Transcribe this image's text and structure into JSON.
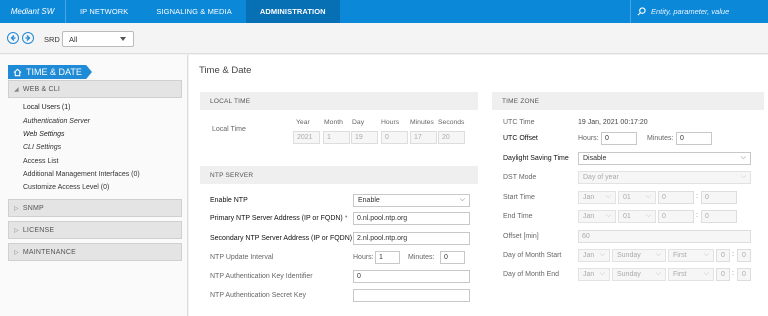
{
  "topbar": {
    "brand": "Mediant SW",
    "tabs": [
      {
        "label": "IP NETWORK"
      },
      {
        "label": "SIGNALING & MEDIA"
      },
      {
        "label": "ADMINISTRATION"
      }
    ],
    "search_placeholder": "Entity, parameter, value"
  },
  "subbar": {
    "srd_label": "SRD",
    "srd_value": "All"
  },
  "sidebar": {
    "title": "TIME & DATE",
    "groups": {
      "web_cli": "WEB & CLI",
      "snmp": "SNMP",
      "license": "LICENSE",
      "maintenance": "MAINTENANCE"
    },
    "items": [
      "Local Users (1)",
      "Authentication Server",
      "Web Settings",
      "CLI Settings",
      "Access List",
      "Additional Management Interfaces (0)",
      "Customize Access Level (0)"
    ]
  },
  "page": {
    "title": "Time & Date"
  },
  "local_time": {
    "header": "LOCAL TIME",
    "label": "Local Time",
    "cols": [
      "Year",
      "Month",
      "Day",
      "Hours",
      "Minutes",
      "Seconds"
    ],
    "values": [
      "2021",
      "1",
      "19",
      "0",
      "17",
      "20"
    ]
  },
  "ntp": {
    "header": "NTP SERVER",
    "enable_label": "Enable NTP",
    "enable_value": "Enable",
    "primary_label": "Primary NTP Server Address (IP or FQDN)",
    "primary_value": "0.nl.pool.ntp.org",
    "secondary_label": "Secondary NTP Server Address (IP or FQDN)",
    "secondary_value": "2.nl.pool.ntp.org",
    "interval_label": "NTP Update Interval",
    "hours_label": "Hours:",
    "hours_value": "1",
    "minutes_label": "Minutes:",
    "minutes_value": "0",
    "keyid_label": "NTP Authentication Key Identifier",
    "keyid_value": "0",
    "secret_label": "NTP Authentication Secret Key",
    "required_mark": "•"
  },
  "timezone": {
    "header": "TIME ZONE",
    "utc_time_label": "UTC Time",
    "utc_time_value": "19 Jan, 2021 00:17:20",
    "utc_offset_label": "UTC Offset",
    "hours_label": "Hours:",
    "hours_value": "0",
    "minutes_label": "Minutes:",
    "minutes_value": "0",
    "dst_label": "Daylight Saving Time",
    "dst_value": "Disable",
    "dst_mode_label": "DST Mode",
    "dst_mode_value": "Day of year",
    "start_label": "Start Time",
    "end_label": "End Time",
    "month_value": "Jan",
    "day_value": "01",
    "zero": "0",
    "offset_label": "Offset [min]",
    "offset_value": "60",
    "dom_start_label": "Day of Month Start",
    "dom_end_label": "Day of Month End",
    "weekday_value": "Sunday",
    "week_value": "First",
    "colon": ":"
  }
}
